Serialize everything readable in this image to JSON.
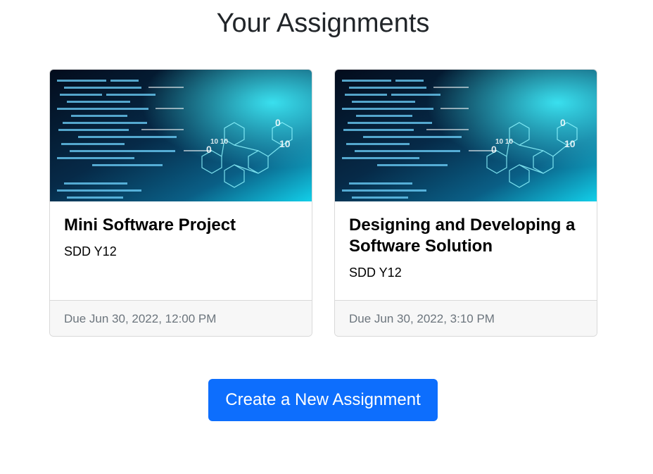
{
  "page": {
    "title": "Your Assignments"
  },
  "assignments": [
    {
      "title": "Mini Software Project",
      "class": "SDD Y12",
      "due": "Due Jun 30, 2022, 12:00 PM"
    },
    {
      "title": "Designing and Developing a Software Solution",
      "class": "SDD Y12",
      "due": "Due Jun 30, 2022, 3:10 PM"
    }
  ],
  "actions": {
    "create_label": "Create a New Assignment"
  },
  "colors": {
    "primary": "#0d6efd",
    "footer_bg": "#f7f7f7",
    "muted_text": "#6c757d",
    "image_dark": "#061427",
    "image_cyan": "#14d8f0"
  },
  "images": {
    "card_image": "code-circuit-banner"
  }
}
